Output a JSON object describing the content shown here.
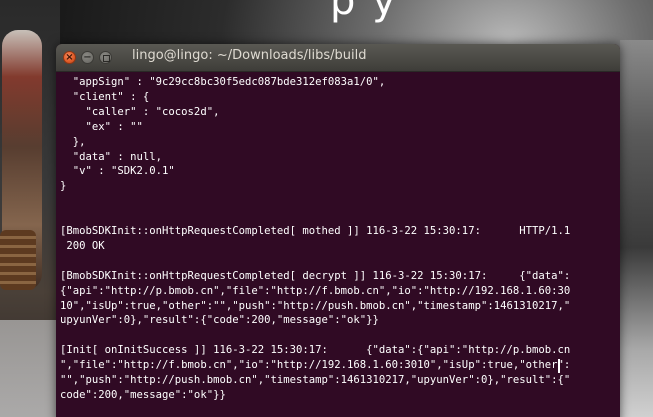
{
  "window": {
    "title": "lingo@lingo: ~/Downloads/libs/build"
  },
  "background": {
    "text": "p y"
  },
  "terminal": {
    "lines": [
      "  \"appSign\" : \"9c29cc8bc30f5edc087bde312ef083a1/0\",",
      "  \"client\" : {",
      "    \"caller\" : \"cocos2d\",",
      "    \"ex\" : \"\"",
      "  },",
      "  \"data\" : null,",
      "  \"v\" : \"SDK2.0.1\"",
      "}",
      "",
      "",
      "[BmobSDKInit::onHttpRequestCompleted[ mothed ]] 116-3-22 15:30:17:      HTTP/1.1",
      " 200 OK",
      "",
      "[BmobSDKInit::onHttpRequestCompleted[ decrypt ]] 116-3-22 15:30:17:     {\"data\":",
      "{\"api\":\"http://p.bmob.cn\",\"file\":\"http://f.bmob.cn\",\"io\":\"http://192.168.1.60:30",
      "10\",\"isUp\":true,\"other\":\"\",\"push\":\"http://push.bmob.cn\",\"timestamp\":1461310217,\"",
      "upyunVer\":0},\"result\":{\"code\":200,\"message\":\"ok\"}}",
      "",
      "[Init[ onInitSuccess ]] 116-3-22 15:30:17:      {\"data\":{\"api\":\"http://p.bmob.cn",
      "\",\"file\":\"http://f.bmob.cn\",\"io\":\"http://192.168.1.60:3010\",\"isUp\":true,\"other\":",
      "\"\",\"push\":\"http://push.bmob.cn\",\"timestamp\":1461310217,\"upyunVer\":0},\"result\":{\"",
      "code\":200,\"message\":\"ok\"}}"
    ]
  },
  "colors": {
    "terminal_bg": "#300a24",
    "terminal_fg": "#ffffff",
    "titlebar": "#4a4945",
    "close_button": "#e25e2a"
  }
}
